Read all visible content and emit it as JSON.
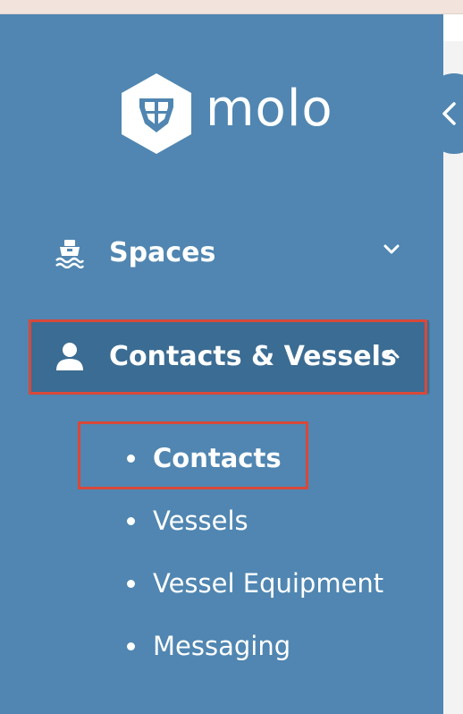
{
  "brand": {
    "name": "molo"
  },
  "sidebar": {
    "items": [
      {
        "label": "Spaces",
        "icon": "boat-icon",
        "expanded": false
      },
      {
        "label": "Contacts & Vessels",
        "icon": "person-icon",
        "expanded": true
      }
    ],
    "subitems": [
      {
        "label": "Contacts",
        "active": true
      },
      {
        "label": "Vessels",
        "active": false
      },
      {
        "label": "Vessel Equipment",
        "active": false
      },
      {
        "label": "Messaging",
        "active": false
      }
    ]
  },
  "colors": {
    "sidebar": "#5086b1",
    "active_item": "#3b6c93",
    "highlight": "#d9483a",
    "text": "#ffffff"
  }
}
